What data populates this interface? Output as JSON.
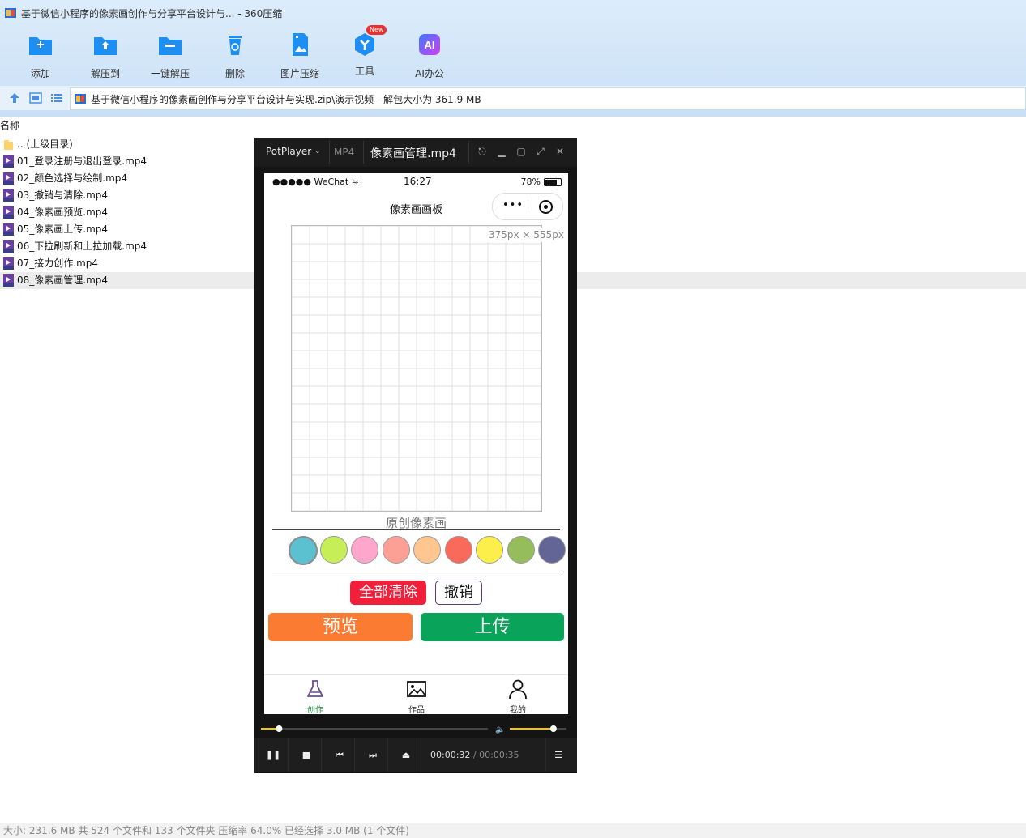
{
  "window": {
    "title": "基于微信小程序的像素画创作与分享平台设计与... - 360压缩"
  },
  "toolbar": {
    "items": [
      {
        "label": "添加",
        "icon": "add-icon"
      },
      {
        "label": "解压到",
        "icon": "extract-to-icon"
      },
      {
        "label": "一键解压",
        "icon": "one-click-extract-icon"
      },
      {
        "label": "删除",
        "icon": "delete-icon"
      },
      {
        "label": "图片压缩",
        "icon": "image-compress-icon"
      },
      {
        "label": "工具",
        "icon": "tools-icon",
        "badge": "New"
      },
      {
        "label": "AI办公",
        "icon": "ai-office-icon"
      }
    ]
  },
  "address": {
    "path": "基于微信小程序的像素画创作与分享平台设计与实现.zip\\演示视频 - 解包大小为 361.9 MB"
  },
  "list": {
    "column_name": "名称",
    "parent": ".. (上级目录)",
    "files": [
      "01_登录注册与退出登录.mp4",
      "02_颜色选择与绘制.mp4",
      "03_撤销与清除.mp4",
      "04_像素画预览.mp4",
      "05_像素画上传.mp4",
      "06_下拉刷新和上拉加载.mp4",
      "07_接力创作.mp4",
      "08_像素画管理.mp4"
    ],
    "selected_index": 7
  },
  "status": {
    "text": "大小: 231.6 MB 共 524 个文件和 133 个文件夹 压缩率 64.0% 已经选择 3.0 MB (1 个文件)"
  },
  "player": {
    "brand": "PotPlayer",
    "format": "MP4",
    "filename": "像素画管理.mp4",
    "current_time": "00:00:32",
    "separator": "/",
    "total_time": "00:00:35",
    "progress": 0.08,
    "volume": 0.77,
    "accent": "#f5c400"
  },
  "phone": {
    "carrier": "●●●●● WeChat",
    "time": "16:27",
    "battery": "78%",
    "page_title": "像素画画板",
    "capsule_dots": "•••",
    "canvas_size_tip": "375px × 555px",
    "canvas_caption": "原创像素画",
    "palette": [
      "#5bc0cf",
      "#c6ef57",
      "#ffa6cd",
      "#fca096",
      "#ffc78f",
      "#fa6a5b",
      "#fcee4b",
      "#96bd5b",
      "#636597"
    ],
    "selected_color_index": 0,
    "buttons": {
      "clear": "全部清除",
      "undo": "撤销",
      "preview": "预览",
      "upload": "上传"
    },
    "tabs": [
      {
        "label": "创作",
        "icon": "flask-icon",
        "active": true
      },
      {
        "label": "作品",
        "icon": "image-icon",
        "active": false
      },
      {
        "label": "我的",
        "icon": "user-icon",
        "active": false
      }
    ]
  }
}
